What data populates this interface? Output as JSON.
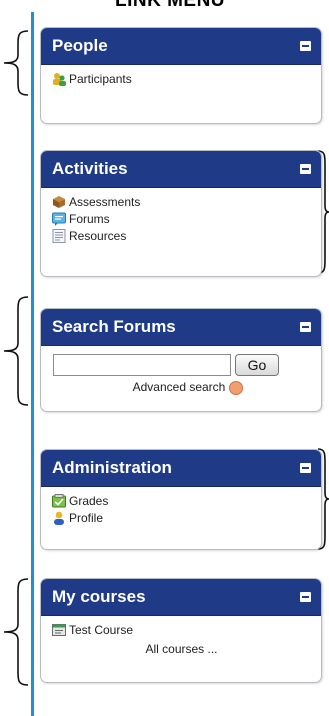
{
  "heading": "LINK MENU",
  "colors": {
    "block_header": "#1f3a87",
    "vertical_line": "#1f8fd8"
  },
  "people": {
    "title": "People",
    "items": [
      {
        "label": "Participants",
        "icon": "participants-icon"
      }
    ]
  },
  "activities": {
    "title": "Activities",
    "items": [
      {
        "label": "Assessments",
        "icon": "assessments-icon"
      },
      {
        "label": "Forums",
        "icon": "forums-icon"
      },
      {
        "label": "Resources",
        "icon": "resources-icon"
      }
    ]
  },
  "search_forums": {
    "title": "Search Forums",
    "input_value": "",
    "go_label": "Go",
    "advanced_label": "Advanced search"
  },
  "administration": {
    "title": "Administration",
    "items": [
      {
        "label": "Grades",
        "icon": "grades-icon"
      },
      {
        "label": "Profile",
        "icon": "profile-icon"
      }
    ]
  },
  "my_courses": {
    "title": "My courses",
    "items": [
      {
        "label": "Test Course",
        "icon": "course-icon"
      }
    ],
    "all_courses_label": "All courses ..."
  }
}
